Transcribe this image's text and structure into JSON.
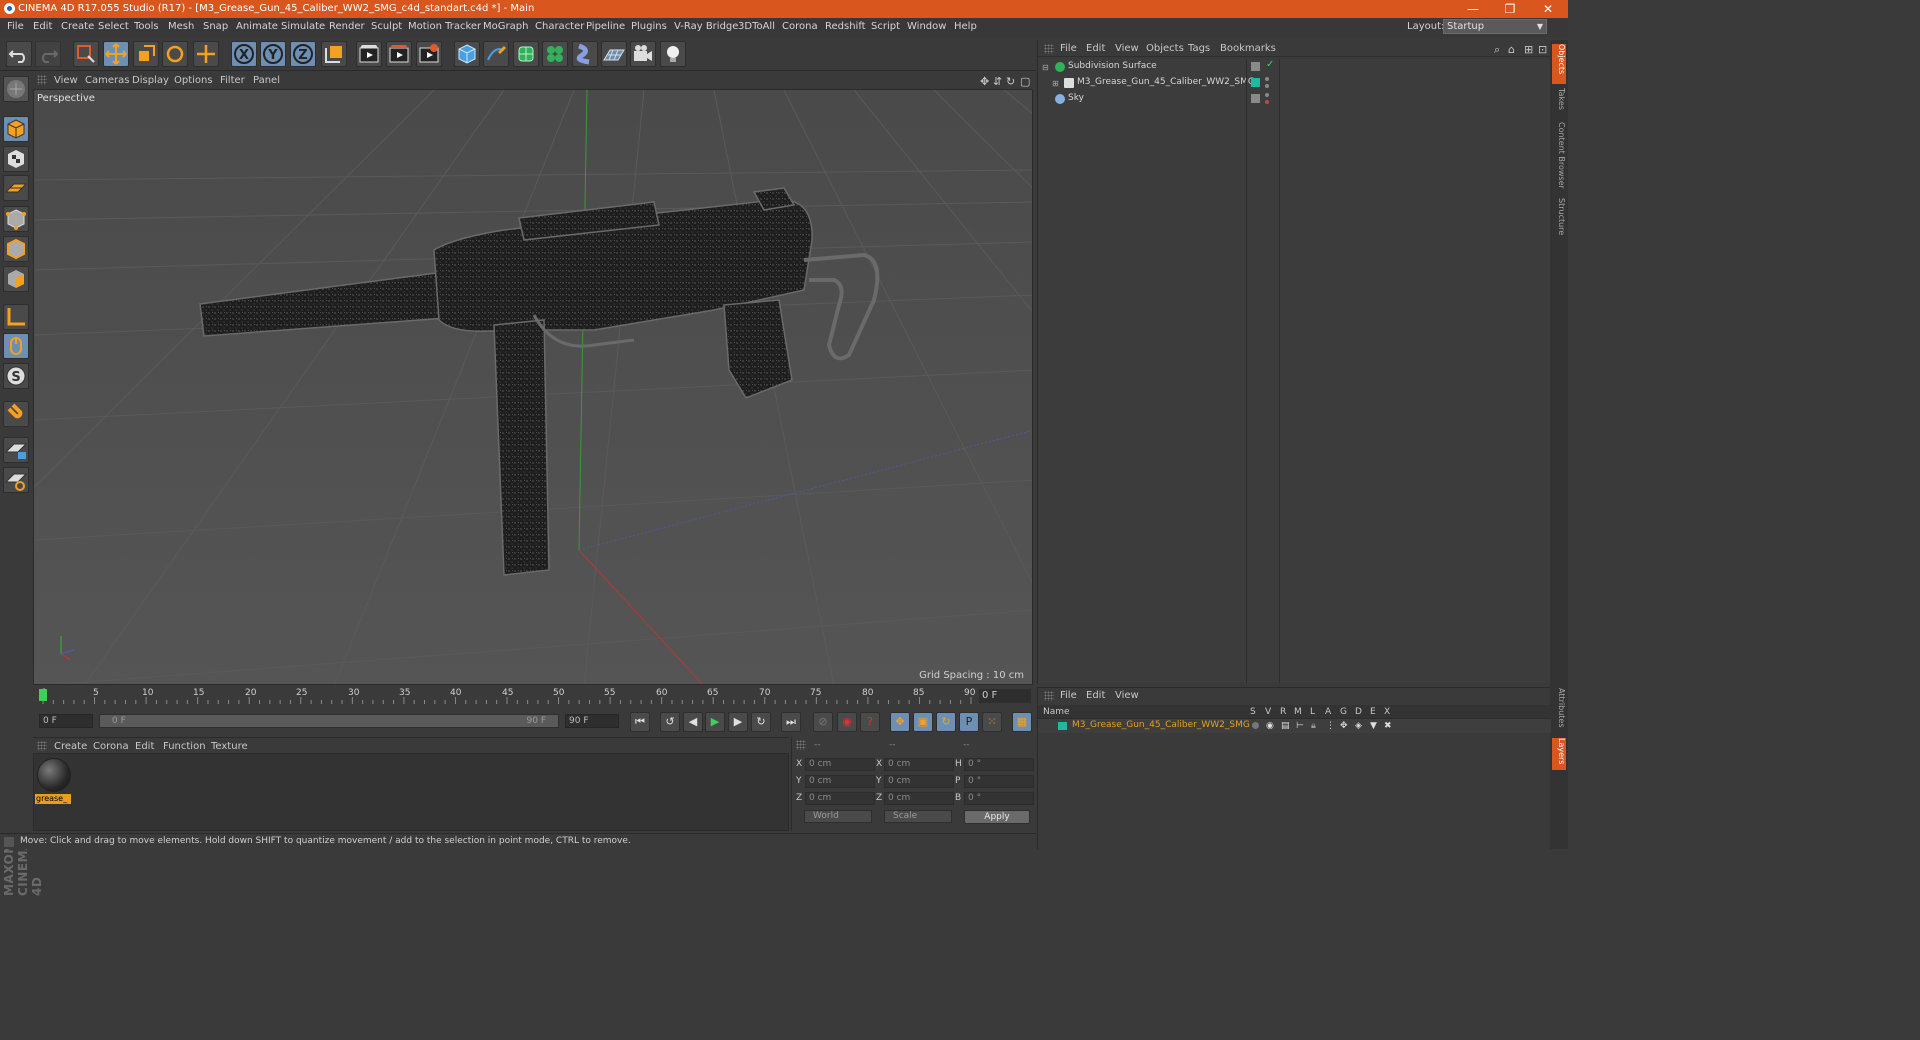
{
  "window": {
    "title": "CINEMA 4D R17.055 Studio (R17) - [M3_Grease_Gun_45_Caliber_WW2_SMG_c4d_standart.c4d *] - Main",
    "minimize": "—",
    "restore": "❐",
    "close": "✕"
  },
  "menubar": {
    "items": [
      "File",
      "Edit",
      "Create",
      "Select",
      "Tools",
      "Mesh",
      "Snap",
      "Animate",
      "Simulate",
      "Render",
      "Sculpt",
      "Motion Tracker",
      "MoGraph",
      "Character",
      "Pipeline",
      "Plugins",
      "V-Ray Bridge",
      "3DToAll",
      "Corona",
      "Redshift",
      "Script",
      "Window",
      "Help"
    ],
    "layout_label": "Layout:",
    "layout_value": "Startup"
  },
  "toolbar": {
    "icons": [
      "undo-icon",
      "redo-icon",
      "live-selection-icon",
      "move-icon",
      "scale-icon",
      "rotate-icon",
      "last-tool-icon",
      "x-axis-icon",
      "y-axis-icon",
      "z-axis-icon",
      "coordinate-system-icon",
      "render-view-icon",
      "render-picture-viewer-icon",
      "edit-render-settings-icon",
      "cube-icon",
      "pen-spline-icon",
      "subdivision-surface-icon",
      "cloner-icon",
      "deformer-icon",
      "floor-icon",
      "camera-icon",
      "light-icon"
    ],
    "axis_x": "X",
    "axis_y": "Y",
    "axis_z": "Z"
  },
  "viewport": {
    "menu": [
      "View",
      "Cameras",
      "Display",
      "Options",
      "Filter",
      "Panel"
    ],
    "label": "Perspective",
    "grid_spacing": "Grid Spacing : 10 cm"
  },
  "timeline": {
    "ticks": [
      "0",
      "5",
      "10",
      "15",
      "20",
      "25",
      "30",
      "35",
      "40",
      "45",
      "50",
      "55",
      "60",
      "65",
      "70",
      "75",
      "80",
      "85",
      "90"
    ],
    "current_frame": "0 F",
    "start_field": "0 F",
    "range_start": "0 F",
    "range_end": "90 F",
    "end_field": "90 F"
  },
  "material_manager": {
    "menu": [
      "Create",
      "Corona",
      "Edit",
      "Function",
      "Texture"
    ],
    "materials": [
      {
        "name": "grease_"
      }
    ]
  },
  "coordinates": {
    "header": [
      "--",
      "--",
      "--"
    ],
    "rows": [
      {
        "pos_label": "X",
        "pos_value": "0 cm",
        "size_label": "X",
        "size_value": "0 cm",
        "rot_label": "H",
        "rot_value": "0 °"
      },
      {
        "pos_label": "Y",
        "pos_value": "0 cm",
        "size_label": "Y",
        "size_value": "0 cm",
        "rot_label": "P",
        "rot_value": "0 °"
      },
      {
        "pos_label": "Z",
        "pos_value": "0 cm",
        "size_label": "Z",
        "size_value": "0 cm",
        "rot_label": "B",
        "rot_value": "0 °"
      }
    ],
    "space": "World",
    "mode": "Scale",
    "apply": "Apply"
  },
  "status": "Move: Click and drag to move elements. Hold down SHIFT to quantize movement / add to the selection in point mode, CTRL to remove.",
  "object_manager": {
    "menu": [
      "File",
      "Edit",
      "View",
      "Objects",
      "Tags",
      "Bookmarks"
    ],
    "objects": [
      {
        "name": "Subdivision Surface"
      },
      {
        "name": "M3_Grease_Gun_45_Caliber_WW2_SMG"
      },
      {
        "name": "Sky"
      }
    ]
  },
  "right_tabs": [
    "Objects",
    "Takes",
    "Content Browser",
    "Structure",
    "Attributes",
    "Layers"
  ],
  "layer_manager": {
    "menu": [
      "File",
      "Edit",
      "View"
    ],
    "columns": [
      "Name",
      "S",
      "V",
      "R",
      "M",
      "L",
      "A",
      "G",
      "D",
      "E",
      "X"
    ],
    "layers": [
      {
        "name": "M3_Grease_Gun_45_Caliber_WW2_SMG",
        "color": "#1fb8a0"
      }
    ]
  },
  "colors": {
    "titlebar": "#d9571e",
    "selection": "#6d8fb3",
    "material_highlight": "#e6a01e",
    "active_name": "#e6a01e"
  }
}
